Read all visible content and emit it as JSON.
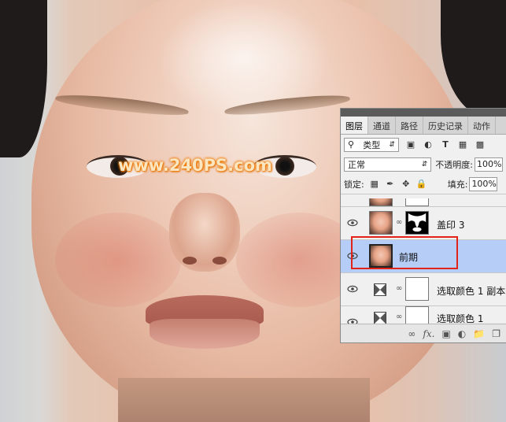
{
  "watermark": "www.240PS.com",
  "layers_panel": {
    "tabs": [
      {
        "label": "图层",
        "active": true
      },
      {
        "label": "通道",
        "active": false
      },
      {
        "label": "路径",
        "active": false
      },
      {
        "label": "历史记录",
        "active": false
      },
      {
        "label": "动作",
        "active": false
      }
    ],
    "filter": {
      "label": "类型"
    },
    "blend_mode": "正常",
    "opacity_label": "不透明度:",
    "opacity_value": "100%",
    "lock_label": "锁定:",
    "fill_label": "填充:",
    "fill_value": "100%",
    "layers": [
      {
        "name": "盖印 3",
        "selected": false,
        "visible": true
      },
      {
        "name": "前期",
        "selected": true,
        "visible": true
      },
      {
        "name": "选取颜色 1 副本",
        "selected": false,
        "visible": true
      },
      {
        "name": "选取颜色 1",
        "selected": false,
        "visible": true
      }
    ],
    "bottom_icons": [
      "link-icon",
      "fx-icon",
      "mask-icon",
      "adjustment-icon",
      "folder-icon",
      "new-layer-icon",
      "trash-icon"
    ],
    "bottom_fx_label": "fx."
  },
  "colors": {
    "selected_row": "#b5cdf7",
    "highlight_box": "#e2231a",
    "watermark_glow": "#f07a00"
  }
}
